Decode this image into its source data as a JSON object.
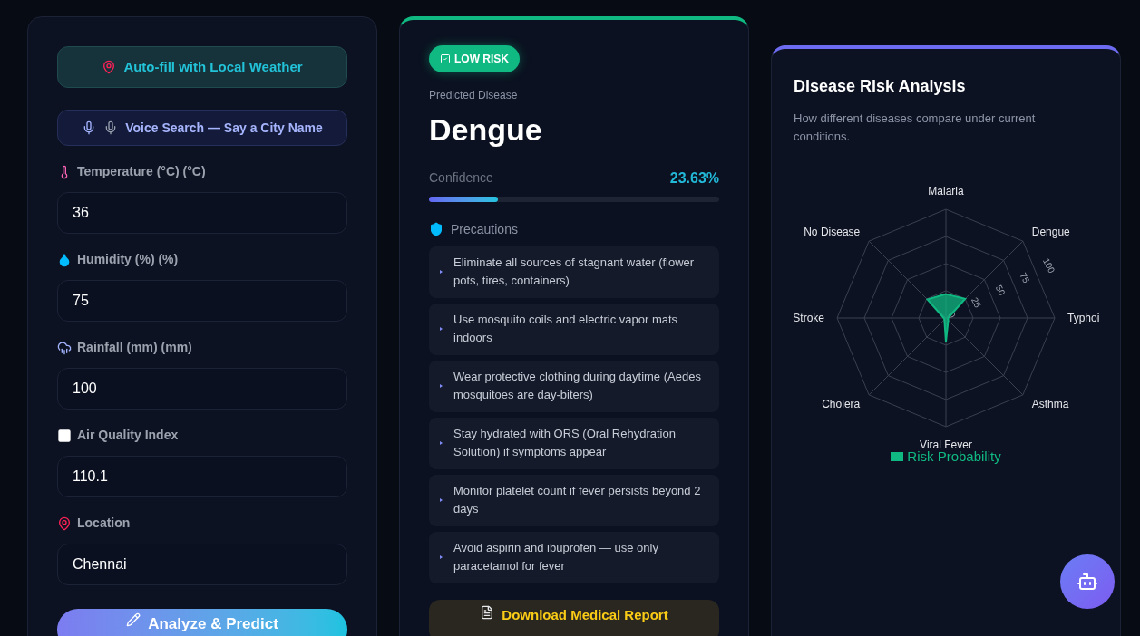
{
  "form": {
    "autofill_button": "Auto-fill with Local Weather",
    "voice_button": "Voice Search — Say a City Name",
    "fields": [
      {
        "kind": "thermometer",
        "label": "Temperature (°C) (°C)",
        "value": "36"
      },
      {
        "kind": "droplet",
        "label": "Humidity (%) (%)",
        "value": "75"
      },
      {
        "kind": "rain",
        "label": "Rainfall (mm) (mm)",
        "value": "100"
      },
      {
        "kind": "square",
        "label": "Air Quality Index",
        "value": "110.1"
      },
      {
        "kind": "pin",
        "label": "Location",
        "value": "Chennai"
      }
    ],
    "submit_button": "Analyze & Predict"
  },
  "result": {
    "risk_badge": "LOW RISK",
    "caption": "Predicted Disease",
    "disease": "Dengue",
    "confidence_label": "Confidence",
    "confidence_value": "23.63%",
    "confidence": {
      "level": 0.2363
    },
    "precautions_title": "Precautions",
    "precautions": [
      "Eliminate all sources of stagnant water (flower pots, tires, containers)",
      "Use mosquito coils and electric vapor mats indoors",
      "Wear protective clothing during daytime (Aedes mosquitoes are day-biters)",
      "Stay hydrated with ORS (Oral Rehydration Solution) if symptoms appear",
      "Monitor platelet count if fever persists beyond 2 days",
      "Avoid aspirin and ibuprofen — use only paracetamol for fever"
    ],
    "download_button": "Download Medical Report"
  },
  "analysis": {
    "title": "Disease Risk Analysis",
    "subtitle": "How different diseases compare under current conditions.",
    "chart_data": {
      "type": "radar",
      "categories": [
        "Malaria",
        "Dengue",
        "Typhoi",
        "Asthma",
        "Viral Fever",
        "Cholera",
        "Stroke",
        "No Disease"
      ],
      "series": [
        {
          "name": "Risk Probability",
          "color": "#10b981",
          "values": [
            22,
            25,
            2,
            3,
            22,
            2,
            2,
            24
          ]
        }
      ],
      "ylim": [
        0,
        100
      ],
      "yticks": [
        0,
        25,
        50,
        75,
        100
      ]
    }
  }
}
